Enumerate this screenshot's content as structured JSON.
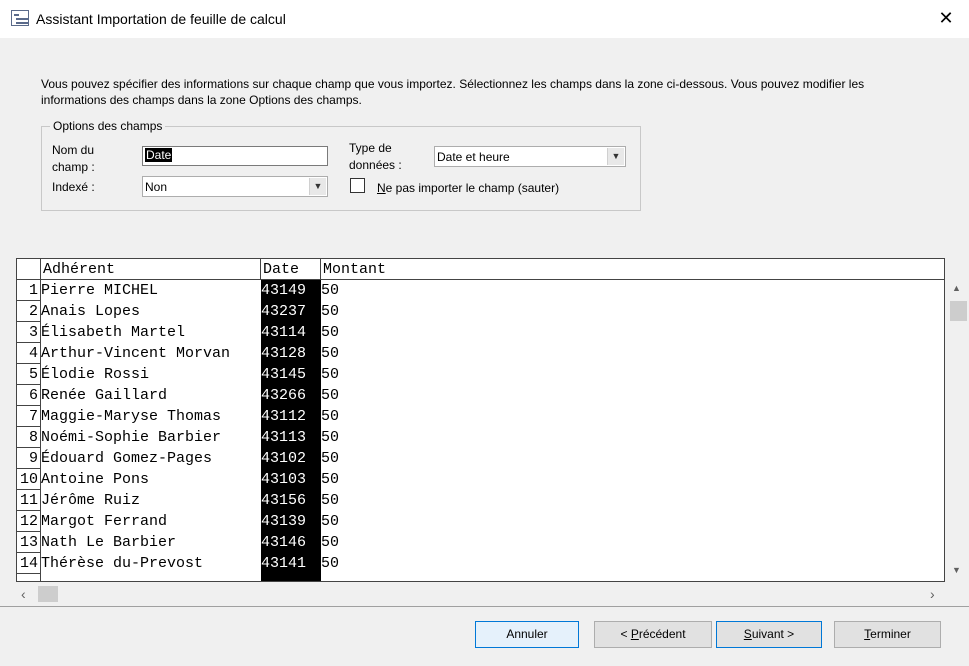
{
  "window": {
    "title": "Assistant Importation de feuille de calcul",
    "close_label": "✕"
  },
  "description": "Vous pouvez spécifier des informations sur chaque champ que vous importez. Sélectionnez les champs dans la zone ci-dessous. Vous pouvez modifier les informations des champs dans la zone Options des champs.",
  "options": {
    "group_label": "Options des champs",
    "field_name_label_1": "Nom du",
    "field_name_label_2": "champ :",
    "field_name_value": "Date",
    "indexed_label": "Indexé :",
    "indexed_value": "Non",
    "type_label_1": "Type de",
    "type_label_2": "données :",
    "type_value": "Date et heure",
    "skip_label": "Ne pas importer le champ (sauter)",
    "skip_checked": false
  },
  "grid": {
    "columns": [
      "Adhérent",
      "Date",
      "Montant"
    ],
    "rows": [
      {
        "n": "1",
        "adherent": "Pierre MICHEL",
        "date": "43149",
        "montant": "50"
      },
      {
        "n": "2",
        "adherent": "Anais Lopes",
        "date": "43237",
        "montant": "50"
      },
      {
        "n": "3",
        "adherent": "Élisabeth Martel",
        "date": "43114",
        "montant": "50"
      },
      {
        "n": "4",
        "adherent": "Arthur-Vincent Morvan",
        "date": "43128",
        "montant": "50"
      },
      {
        "n": "5",
        "adherent": "Élodie Rossi",
        "date": "43145",
        "montant": "50"
      },
      {
        "n": "6",
        "adherent": "Renée Gaillard",
        "date": "43266",
        "montant": "50"
      },
      {
        "n": "7",
        "adherent": "Maggie-Maryse Thomas",
        "date": "43112",
        "montant": "50"
      },
      {
        "n": "8",
        "adherent": "Noémi-Sophie Barbier",
        "date": "43113",
        "montant": "50"
      },
      {
        "n": "9",
        "adherent": "Édouard Gomez-Pages",
        "date": "43102",
        "montant": "50"
      },
      {
        "n": "10",
        "adherent": "Antoine Pons",
        "date": "43103",
        "montant": "50"
      },
      {
        "n": "11",
        "adherent": "Jérôme Ruiz",
        "date": "43156",
        "montant": "50"
      },
      {
        "n": "12",
        "adherent": "Margot Ferrand",
        "date": "43139",
        "montant": "50"
      },
      {
        "n": "13",
        "adherent": "Nath Le Barbier",
        "date": "43146",
        "montant": "50"
      },
      {
        "n": "14",
        "adherent": "Thérèse du-Prevost",
        "date": "43141",
        "montant": "50"
      }
    ]
  },
  "buttons": {
    "cancel": "Annuler",
    "previous": "< Précédent",
    "next": "Suivant >",
    "finish": "Terminer"
  }
}
